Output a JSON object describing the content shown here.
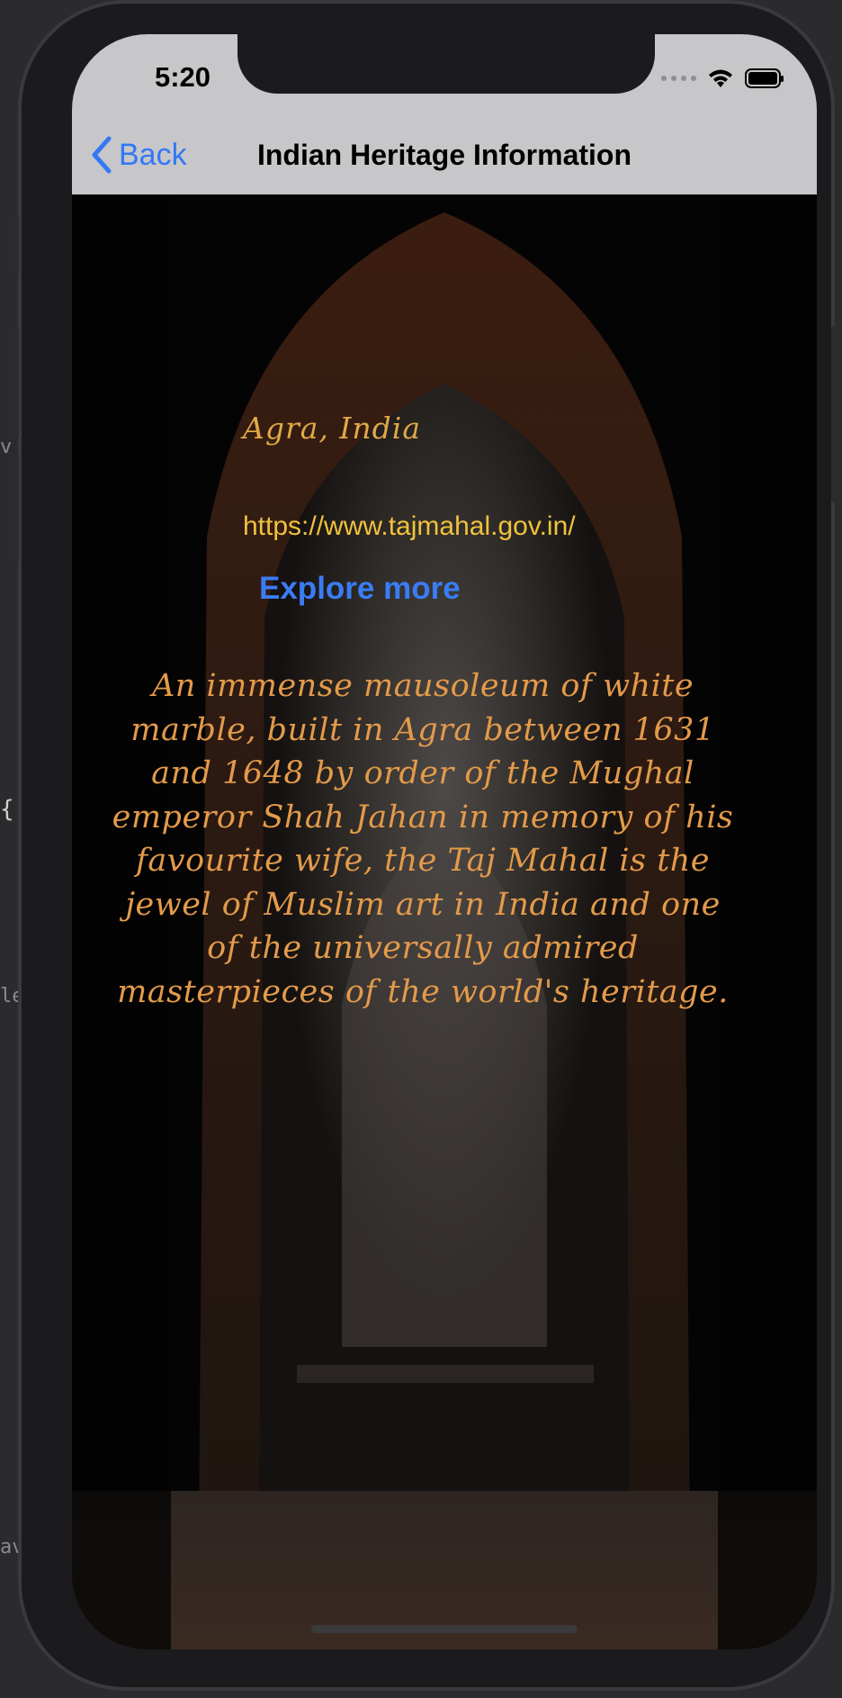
{
  "status_bar": {
    "time": "5:20"
  },
  "navigation": {
    "back_label": "Back",
    "title": "Indian Heritage Information"
  },
  "heritage": {
    "location": "Agra, India",
    "website": "https://www.tajmahal.gov.in/",
    "explore_label": "Explore more",
    "description": "An immense mausoleum of white marble, built in Agra between 1631 and 1648 by order of the Mughal emperor Shah Jahan in memory of his favourite wife, the Taj Mahal is the jewel of Muslim art in India and one of the universally admired masterpieces of the world's heritage."
  },
  "editor_fragments": {
    "frag_1": "v",
    "frag_2": "{",
    "frag_3": "le",
    "frag_4": "av"
  },
  "colors": {
    "accent": "#3478f6",
    "nav_background": "#c7c7c9",
    "location_text": "#e0a848",
    "website_text": "#f0c23c",
    "description_text": "#e39a4a"
  }
}
